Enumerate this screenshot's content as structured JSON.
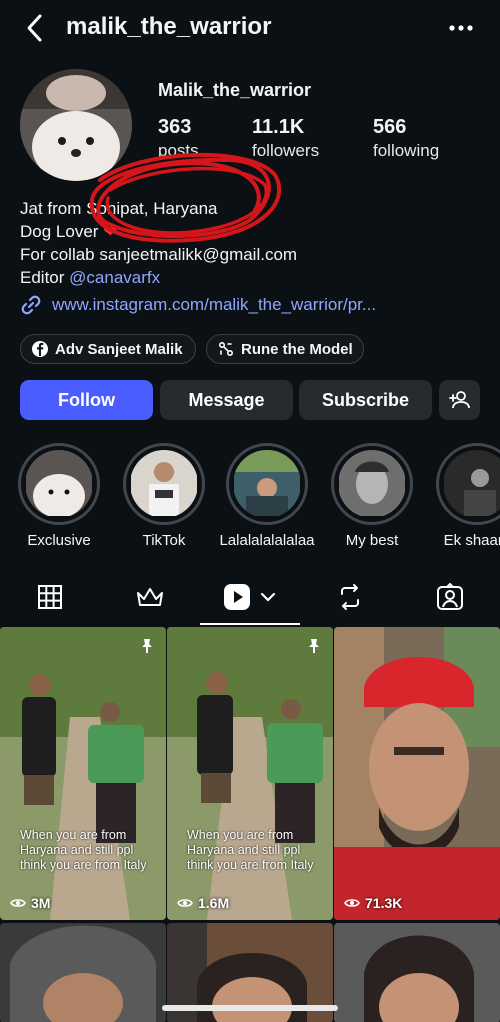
{
  "header": {
    "username": "malik_the_warrior"
  },
  "profile": {
    "display_name": "Malik_the_warrior",
    "stats": [
      {
        "value": "363",
        "label": "posts"
      },
      {
        "value": "11.1K",
        "label": "followers"
      },
      {
        "value": "566",
        "label": "following"
      }
    ],
    "bio_lines": [
      "Jat from Sonipat, Haryana",
      "Dog Lover",
      "For collab sanjeetmalikk@gmail.com"
    ],
    "bio_editor_prefix": "Editor",
    "bio_editor_mention": "@canavarfx",
    "link": "www.instagram.com/malik_the_warrior/pr..."
  },
  "chips": [
    {
      "label": "Adv Sanjeet Malik",
      "icon": "facebook-icon"
    },
    {
      "label": "Rune the Model",
      "icon": "threads-icon"
    }
  ],
  "actions": {
    "follow": "Follow",
    "message": "Message",
    "subscribe": "Subscribe"
  },
  "highlights": [
    {
      "label": "Exclusive"
    },
    {
      "label": "TikTok"
    },
    {
      "label": "Lalalalalalalaa"
    },
    {
      "label": "My best"
    },
    {
      "label": "Ek shaam"
    }
  ],
  "tabs": [
    "grid-icon",
    "crown-icon",
    "reels-icon",
    "repost-icon",
    "tagged-icon"
  ],
  "posts": [
    {
      "caption": [
        "When you are from",
        "Haryana and still ppl",
        "think you are from Italy"
      ],
      "views": "3M",
      "pinned": true
    },
    {
      "caption": [
        "When you are from",
        "Haryana and still ppl",
        "think you are from Italy"
      ],
      "views": "1.6M",
      "pinned": true
    },
    {
      "caption": [],
      "views": "71.3K",
      "pinned": false
    }
  ],
  "colors": {
    "accent": "#4a5dff",
    "link": "#8fa7ff",
    "background": "#0b1014",
    "scribble": "#d4161a"
  }
}
